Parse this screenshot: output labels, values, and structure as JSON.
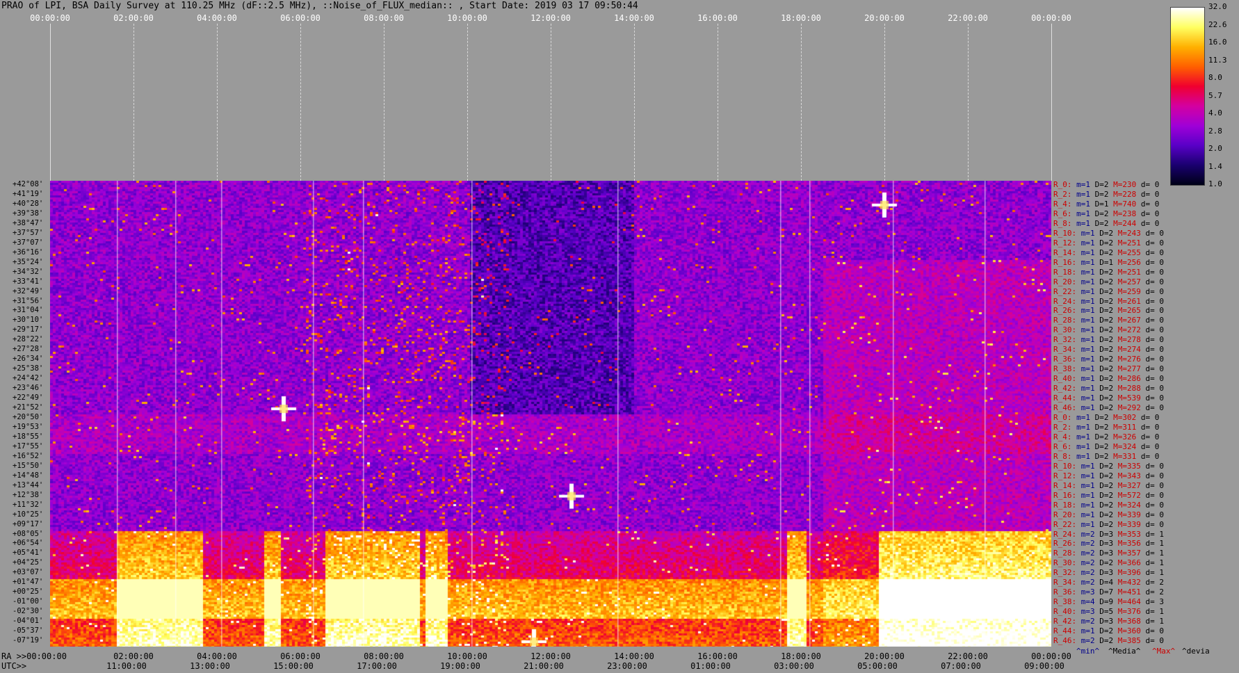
{
  "title": "PRAO of LPI, BSA Daily Survey at 110.25 MHz (dF::2.5 MHz), ::Noise_of_FLUX_median:: , Start Date: 2019 03 17 09:50:44",
  "chart_data": {
    "type": "heatmap",
    "title": "PRAO of LPI, BSA Daily Survey at 110.25 MHz (dF::2.5 MHz), ::Noise_of_FLUX_median:: , Start Date: 2019 03 17 09:50:44",
    "top_ticks": [
      "00:00:00",
      "02:00:00",
      "04:00:00",
      "06:00:00",
      "08:00:00",
      "10:00:00",
      "12:00:00",
      "14:00:00",
      "16:00:00",
      "18:00:00",
      "20:00:00",
      "22:00:00",
      "00:00:00"
    ],
    "ra_ticks": [
      "RA >>00:00:00",
      "02:00:00",
      "04:00:00",
      "06:00:00",
      "08:00:00",
      "10:00:00",
      "12:00:00",
      "14:00:00",
      "16:00:00",
      "18:00:00",
      "20:00:00",
      "22:00:00",
      "00:00:00"
    ],
    "utc_ticks": [
      "UTC>>",
      "11:00:00",
      "13:00:00",
      "15:00:00",
      "17:00:00",
      "19:00:00",
      "21:00:00",
      "23:00:00",
      "01:00:00",
      "03:00:00",
      "05:00:00",
      "07:00:00",
      "09:00:00"
    ],
    "dec_labels": [
      "+42°08'",
      "+41°19'",
      "+40°28'",
      "+39°38'",
      "+38°47'",
      "+37°57'",
      "+37°07'",
      "+36°16'",
      "+35°24'",
      "+34°32'",
      "+33°41'",
      "+32°49'",
      "+31°56'",
      "+31°04'",
      "+30°10'",
      "+29°17'",
      "+28°22'",
      "+27°28'",
      "+26°34'",
      "+25°38'",
      "+24°42'",
      "+23°46'",
      "+22°49'",
      "+21°52'",
      "+20°50'",
      "+19°53'",
      "+18°55'",
      "+17°55'",
      "+16°52'",
      "+15°50'",
      "+14°48'",
      "+13°44'",
      "+12°38'",
      "+11°32'",
      "+10°25'",
      "+09°17'",
      "+08°05'",
      "+06°54'",
      "+05°41'",
      "+04°25'",
      "+03°07'",
      "+01°47'",
      "+00°25'",
      "-01°00'",
      "-02°30'",
      "-04°01'",
      "-05°37'",
      "-07°19'"
    ],
    "stats": [
      {
        "r": "R_0:",
        "m": "m=1",
        "D": "D=2",
        "M": "M=230",
        "d": "d= 0"
      },
      {
        "r": "R_2:",
        "m": "m=1",
        "D": "D=2",
        "M": "M=228",
        "d": "d= 0"
      },
      {
        "r": "R_4:",
        "m": "m=1",
        "D": "D=1",
        "M": "M=740",
        "d": "d= 0"
      },
      {
        "r": "R_6:",
        "m": "m=1",
        "D": "D=2",
        "M": "M=238",
        "d": "d= 0"
      },
      {
        "r": "R_8:",
        "m": "m=1",
        "D": "D=2",
        "M": "M=244",
        "d": "d= 0"
      },
      {
        "r": "R_10:",
        "m": "m=1",
        "D": "D=2",
        "M": "M=243",
        "d": "d= 0"
      },
      {
        "r": "R_12:",
        "m": "m=1",
        "D": "D=2",
        "M": "M=251",
        "d": "d= 0"
      },
      {
        "r": "R_14:",
        "m": "m=1",
        "D": "D=2",
        "M": "M=255",
        "d": "d= 0"
      },
      {
        "r": "R_16:",
        "m": "m=1",
        "D": "D=1",
        "M": "M=256",
        "d": "d= 0"
      },
      {
        "r": "R_18:",
        "m": "m=1",
        "D": "D=2",
        "M": "M=251",
        "d": "d= 0"
      },
      {
        "r": "R_20:",
        "m": "m=1",
        "D": "D=2",
        "M": "M=257",
        "d": "d= 0"
      },
      {
        "r": "R_22:",
        "m": "m=1",
        "D": "D=2",
        "M": "M=259",
        "d": "d= 0"
      },
      {
        "r": "R_24:",
        "m": "m=1",
        "D": "D=2",
        "M": "M=261",
        "d": "d= 0"
      },
      {
        "r": "R_26:",
        "m": "m=1",
        "D": "D=2",
        "M": "M=265",
        "d": "d= 0"
      },
      {
        "r": "R_28:",
        "m": "m=1",
        "D": "D=2",
        "M": "M=267",
        "d": "d= 0"
      },
      {
        "r": "R_30:",
        "m": "m=1",
        "D": "D=2",
        "M": "M=272",
        "d": "d= 0"
      },
      {
        "r": "R_32:",
        "m": "m=1",
        "D": "D=2",
        "M": "M=278",
        "d": "d= 0"
      },
      {
        "r": "R_34:",
        "m": "m=1",
        "D": "D=2",
        "M": "M=274",
        "d": "d= 0"
      },
      {
        "r": "R_36:",
        "m": "m=1",
        "D": "D=2",
        "M": "M=276",
        "d": "d= 0"
      },
      {
        "r": "R_38:",
        "m": "m=1",
        "D": "D=2",
        "M": "M=277",
        "d": "d= 0"
      },
      {
        "r": "R_40:",
        "m": "m=1",
        "D": "D=2",
        "M": "M=286",
        "d": "d= 0"
      },
      {
        "r": "R_42:",
        "m": "m=1",
        "D": "D=2",
        "M": "M=288",
        "d": "d= 0"
      },
      {
        "r": "R_44:",
        "m": "m=1",
        "D": "D=2",
        "M": "M=539",
        "d": "d= 0"
      },
      {
        "r": "R_46:",
        "m": "m=1",
        "D": "D=2",
        "M": "M=292",
        "d": "d= 0"
      },
      {
        "r": "R_0:",
        "m": "m=1",
        "D": "D=2",
        "M": "M=302",
        "d": "d= 0"
      },
      {
        "r": "R_2:",
        "m": "m=1",
        "D": "D=2",
        "M": "M=311",
        "d": "d= 0"
      },
      {
        "r": "R_4:",
        "m": "m=1",
        "D": "D=2",
        "M": "M=326",
        "d": "d= 0"
      },
      {
        "r": "R_6:",
        "m": "m=1",
        "D": "D=2",
        "M": "M=324",
        "d": "d= 0"
      },
      {
        "r": "R_8:",
        "m": "m=1",
        "D": "D=2",
        "M": "M=331",
        "d": "d= 0"
      },
      {
        "r": "R_10:",
        "m": "m=1",
        "D": "D=2",
        "M": "M=335",
        "d": "d= 0"
      },
      {
        "r": "R_12:",
        "m": "m=1",
        "D": "D=2",
        "M": "M=343",
        "d": "d= 0"
      },
      {
        "r": "R_14:",
        "m": "m=1",
        "D": "D=2",
        "M": "M=327",
        "d": "d= 0"
      },
      {
        "r": "R_16:",
        "m": "m=1",
        "D": "D=2",
        "M": "M=572",
        "d": "d= 0"
      },
      {
        "r": "R_18:",
        "m": "m=1",
        "D": "D=2",
        "M": "M=324",
        "d": "d= 0"
      },
      {
        "r": "R_20:",
        "m": "m=1",
        "D": "D=2",
        "M": "M=339",
        "d": "d= 0"
      },
      {
        "r": "R_22:",
        "m": "m=1",
        "D": "D=2",
        "M": "M=339",
        "d": "d= 0"
      },
      {
        "r": "R_24:",
        "m": "m=2",
        "D": "D=3",
        "M": "M=353",
        "d": "d= 1"
      },
      {
        "r": "R_26:",
        "m": "m=2",
        "D": "D=3",
        "M": "M=356",
        "d": "d= 1"
      },
      {
        "r": "R_28:",
        "m": "m=2",
        "D": "D=3",
        "M": "M=357",
        "d": "d= 1"
      },
      {
        "r": "R_30:",
        "m": "m=2",
        "D": "D=2",
        "M": "M=366",
        "d": "d= 1"
      },
      {
        "r": "R_32:",
        "m": "m=2",
        "D": "D=3",
        "M": "M=396",
        "d": "d= 1"
      },
      {
        "r": "R_34:",
        "m": "m=2",
        "D": "D=4",
        "M": "M=432",
        "d": "d= 2"
      },
      {
        "r": "R_36:",
        "m": "m=3",
        "D": "D=7",
        "M": "M=451",
        "d": "d= 2"
      },
      {
        "r": "R_38:",
        "m": "m=4",
        "D": "D=9",
        "M": "M=464",
        "d": "d= 3"
      },
      {
        "r": "R_40:",
        "m": "m=3",
        "D": "D=5",
        "M": "M=376",
        "d": "d= 1"
      },
      {
        "r": "R_42:",
        "m": "m=2",
        "D": "D=3",
        "M": "M=368",
        "d": "d= 1"
      },
      {
        "r": "R_44:",
        "m": "m=1",
        "D": "D=2",
        "M": "M=360",
        "d": "d= 0"
      },
      {
        "r": "R_46:",
        "m": "m=2",
        "D": "D=2",
        "M": "M=385",
        "d": "d= 0"
      }
    ],
    "legend": {
      "min": "^min^",
      "media": "^Media^",
      "max": "^Max^",
      "devia": "^devia"
    },
    "colorbar_labels": [
      "32.0",
      "22.6",
      "16.0",
      "11.3",
      "8.0",
      "5.7",
      "4.0",
      "2.8",
      "2.0",
      "1.4",
      "1.0"
    ],
    "colorbar_scale": "log",
    "colormap": [
      "#000018",
      "#1a0070",
      "#5a00c8",
      "#a000d8",
      "#d400a0",
      "#f00030",
      "#ff6000",
      "#ffb000",
      "#ffff60",
      "#ffffff"
    ],
    "events": [
      {
        "ra_hour": 20.0,
        "row": 2,
        "strength": 1.0
      },
      {
        "ra_hour": 5.6,
        "row": 23,
        "strength": 0.8
      },
      {
        "ra_hour": 12.5,
        "row": 32,
        "strength": 0.9
      },
      {
        "ra_hour": 11.6,
        "row": 47,
        "strength": 1.0
      }
    ],
    "bright_bands": [
      {
        "from": 1.6,
        "to": 3.6
      },
      {
        "from": 5.1,
        "to": 5.5
      },
      {
        "from": 6.6,
        "to": 8.8
      },
      {
        "from": 9.0,
        "to": 9.5
      },
      {
        "from": 17.6,
        "to": 18.1
      },
      {
        "from": 19.8,
        "to": 24.0
      }
    ]
  }
}
